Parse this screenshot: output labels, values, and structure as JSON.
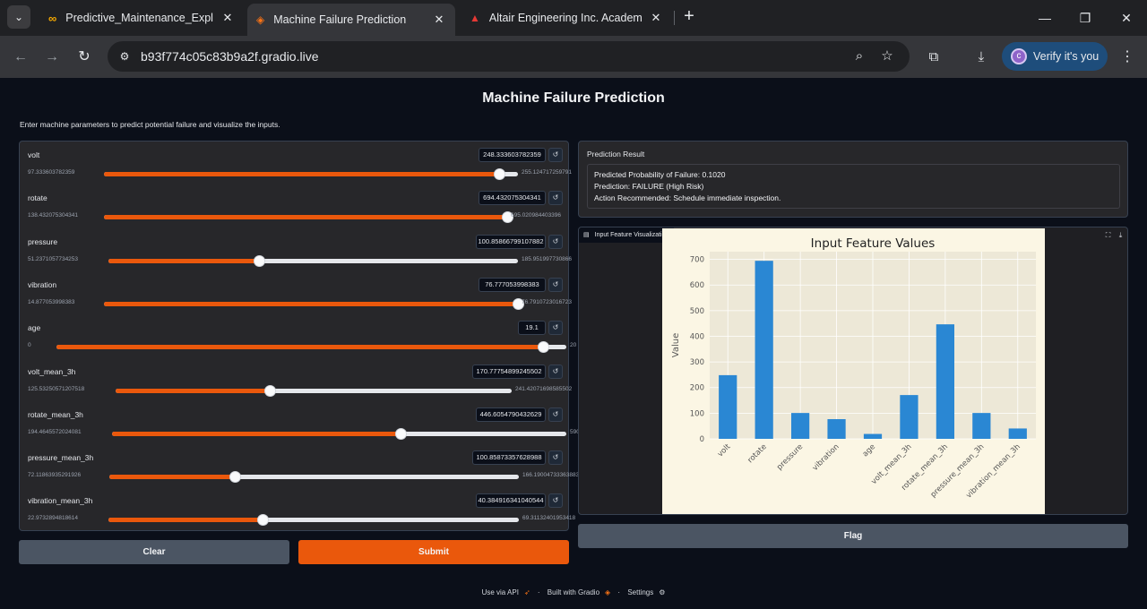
{
  "browser": {
    "tabs": [
      {
        "title": "Predictive_Maintenance_Explorato",
        "icon": "colab-icon",
        "active": false
      },
      {
        "title": "Machine Failure Prediction",
        "icon": "gradio-icon",
        "active": true
      },
      {
        "title": "Altair Engineering Inc. Academy Le",
        "icon": "altair-icon",
        "active": false
      }
    ],
    "url": "b93f774c05c83b9a2f.gradio.live",
    "verify_label": "Verify it's you",
    "avatar_letter": "c"
  },
  "app": {
    "title": "Machine Failure Prediction",
    "description": "Enter machine parameters to predict potential failure and visualize the inputs."
  },
  "params": [
    {
      "label": "volt",
      "value": "248.333603782359",
      "min": "97.333603782359",
      "max": "255.124717259791",
      "fraction": 0.955
    },
    {
      "label": "rotate",
      "value": "694.432075304341",
      "min": "138.432075304341",
      "max": "695.020984403396",
      "fraction": 0.999
    },
    {
      "label": "pressure",
      "value": "100.85866799107882",
      "min": "51.2371057734253",
      "max": "185.951997730866",
      "fraction": 0.368
    },
    {
      "label": "vibration",
      "value": "76.777053998383",
      "min": "14.877053998383",
      "max": "76.7910723016723",
      "fraction": 0.999
    },
    {
      "label": "age",
      "value": "19.1",
      "min": "0",
      "max": "20",
      "fraction": 0.955
    },
    {
      "label": "volt_mean_3h",
      "value": "170.77754899245502",
      "min": "125.53250571207518",
      "max": "241.42071698585502",
      "fraction": 0.39
    },
    {
      "label": "rotate_mean_3h",
      "value": "446.6054790432629",
      "min": "194.4645572024081",
      "max": "590.6429535036123",
      "fraction": 0.636
    },
    {
      "label": "pressure_mean_3h",
      "value": "100.85873357628988",
      "min": "72.11863935291926",
      "max": "166.19004733363883",
      "fraction": 0.306
    },
    {
      "label": "vibration_mean_3h",
      "value": "40.384916341040544",
      "min": "22.9732894818614",
      "max": "69.31132401953418",
      "fraction": 0.376
    }
  ],
  "buttons": {
    "clear": "Clear",
    "submit": "Submit",
    "flag": "Flag"
  },
  "result": {
    "label": "Prediction Result",
    "lines": [
      "Predicted Probability of Failure: 0.1020",
      "Prediction: FAILURE (High Risk)",
      "Action Recommended: Schedule immediate inspection."
    ]
  },
  "plot": {
    "label": "Input Feature Visualization"
  },
  "chart_data": {
    "type": "bar",
    "title": "Input Feature Values",
    "xlabel": "",
    "ylabel": "Value",
    "categories": [
      "volt",
      "rotate",
      "pressure",
      "vibration",
      "age",
      "volt_mean_3h",
      "rotate_mean_3h",
      "pressure_mean_3h",
      "vibration_mean_3h"
    ],
    "values": [
      248.33,
      694.43,
      100.86,
      76.78,
      19.1,
      170.78,
      446.61,
      100.86,
      40.38
    ],
    "yticks": [
      0,
      100,
      200,
      300,
      400,
      500,
      600,
      700
    ],
    "ylim": [
      0,
      730
    ],
    "grid": true,
    "colors": {
      "bar": "#2a87d3",
      "axes_bg": "#ede8d7",
      "fig_bg": "#fbf6e4"
    }
  },
  "footer": {
    "api": "Use via API",
    "built": "Built with Gradio",
    "settings": "Settings"
  }
}
